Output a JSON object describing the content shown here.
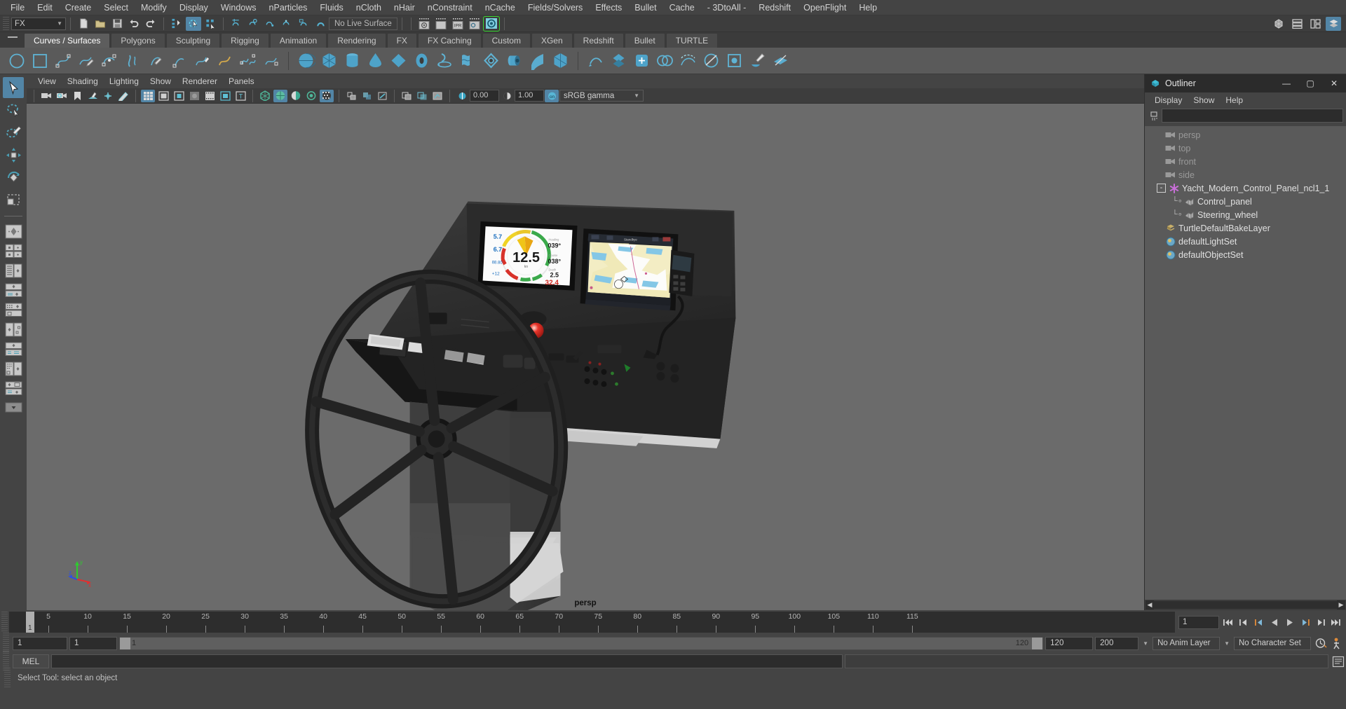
{
  "app": {
    "title": "Autodesk Maya"
  },
  "menubar": {
    "items": [
      "File",
      "Edit",
      "Create",
      "Select",
      "Modify",
      "Display",
      "Windows",
      "nParticles",
      "Fluids",
      "nCloth",
      "nHair",
      "nConstraint",
      "nCache",
      "Fields/Solvers",
      "Effects",
      "Bullet",
      "Cache",
      "- 3DtoAll -",
      "Redshift",
      "OpenFlight",
      "Help"
    ]
  },
  "statusline": {
    "menuset": "FX",
    "live_surface": "No Live Surface",
    "icons": [
      "new-scene-icon",
      "open-scene-icon",
      "save-scene-icon",
      "undo-icon",
      "redo-icon",
      "select-by-hierarchy-icon",
      "select-by-object-icon",
      "select-by-component-icon",
      "snap-to-grid-icon",
      "snap-to-curve-icon",
      "snap-to-point-icon",
      "snap-to-projected-center-icon",
      "snap-to-view-plane-icon",
      "magnet-icon",
      "render-current-frame-icon",
      "render-sequence-icon",
      "ipr-render-icon",
      "render-settings-icon",
      "hypershade-icon"
    ],
    "right_icons": [
      "show-hide-modeling-toolkit-icon",
      "show-hide-attribute-editor-icon",
      "show-hide-tool-settings-icon",
      "show-hide-channel-box-icon"
    ]
  },
  "shelf": {
    "tabs": [
      "Curves / Surfaces",
      "Polygons",
      "Sculpting",
      "Rigging",
      "Animation",
      "Rendering",
      "FX",
      "FX Caching",
      "Custom",
      "XGen",
      "Redshift",
      "Bullet",
      "TURTLE"
    ],
    "active_tab": "Curves / Surfaces",
    "icons": [
      "nurbs-circle-icon",
      "nurbs-square-icon",
      "cv-curve-tool-icon",
      "ep-curve-tool-icon",
      "bezier-curve-tool-icon",
      "pencil-curve-tool-icon",
      "three-point-arc-icon",
      "two-point-arc-icon",
      "add-points-tool-icon",
      "attach-curves-icon",
      "detach-curves-icon",
      "insert-knot-icon",
      "offset-curve-icon",
      "poly-sphere-icon",
      "poly-cube-icon",
      "poly-cylinder-icon",
      "poly-cone-icon",
      "poly-plane-icon",
      "poly-torus-icon",
      "revolve-icon",
      "loft-icon",
      "planar-icon",
      "extrude-icon",
      "birail-icon",
      "boundary-icon",
      "square-surface-icon",
      "bevel-icon",
      "bevel-plus-icon",
      "intersect-surfaces-icon",
      "project-curve-icon",
      "trim-tool-icon",
      "untrim-surfaces-icon",
      "sculpt-geometry-tool-icon",
      "surface-editing-icon"
    ]
  },
  "toolbox": {
    "items": [
      "select-tool",
      "lasso-select-tool",
      "paint-select-tool",
      "move-tool",
      "rotate-tool",
      "scale-tool",
      "last-tool-used",
      "layout-single-pane",
      "layout-two-pane-side",
      "layout-two-pane-stacked",
      "layout-three-pane",
      "layout-four-pane",
      "layout-persp-outliner",
      "layout-hypershade",
      "layout-persp-graph",
      "layout-outliner-persp",
      "layout-more"
    ],
    "active": "select-tool"
  },
  "viewport": {
    "menus": [
      "View",
      "Shading",
      "Lighting",
      "Show",
      "Renderer",
      "Panels"
    ],
    "camera_label": "persp",
    "exposure": "0.00",
    "gamma": "1.00",
    "color_space": "sRGB gamma",
    "toolbar_icons": [
      "select-camera-icon",
      "camera-attributes-icon",
      "bookmark-icon",
      "image-plane-icon",
      "two-d-pan-zoom-icon",
      "grease-pencil-icon",
      "grid-icon",
      "film-gate-icon",
      "resolution-gate-icon",
      "gate-mask-icon",
      "film-origin-icon",
      "safe-action-icon",
      "safe-title-icon",
      "wireframe-icon",
      "smooth-shade-all-icon",
      "shaded-with-wireframe-icon",
      "use-all-lights-icon",
      "shadows-icon",
      "screen-space-ao-icon",
      "motion-blur-icon",
      "multisample-aa-icon",
      "depth-of-field-icon",
      "isolate-select-icon",
      "xray-icon",
      "xray-joints-icon",
      "xray-active-components-icon",
      "exposure-icon",
      "gamma-icon",
      "color-management-icon"
    ],
    "axis_labels": [
      "x",
      "y",
      "z"
    ]
  },
  "outliner": {
    "title": "Outliner",
    "window_buttons": [
      "minimize",
      "maximize",
      "close"
    ],
    "menus": [
      "Display",
      "Show",
      "Help"
    ],
    "search_placeholder": "",
    "search_value": "",
    "tree": [
      {
        "label": "persp",
        "icon": "camera-icon",
        "indent": 2,
        "dim": true,
        "expander": ""
      },
      {
        "label": "top",
        "icon": "camera-icon",
        "indent": 2,
        "dim": true,
        "expander": ""
      },
      {
        "label": "front",
        "icon": "camera-icon",
        "indent": 2,
        "dim": true,
        "expander": ""
      },
      {
        "label": "side",
        "icon": "camera-icon",
        "indent": 2,
        "dim": true,
        "expander": ""
      },
      {
        "label": "Yacht_Modern_Control_Panel_ncl1_1",
        "icon": "transform-icon",
        "indent": 1,
        "dim": false,
        "expander": "-"
      },
      {
        "label": "Control_panel",
        "icon": "mesh-icon",
        "indent": 3,
        "dim": false,
        "expander": ""
      },
      {
        "label": "Steering_wheel",
        "icon": "mesh-icon",
        "indent": 3,
        "dim": false,
        "expander": ""
      },
      {
        "label": "TurtleDefaultBakeLayer",
        "icon": "bakelayer-icon",
        "indent": 2,
        "dim": false,
        "expander": ""
      },
      {
        "label": "defaultLightSet",
        "icon": "set-icon",
        "indent": 2,
        "dim": false,
        "expander": ""
      },
      {
        "label": "defaultObjectSet",
        "icon": "set-icon",
        "indent": 2,
        "dim": false,
        "expander": ""
      }
    ]
  },
  "timeline": {
    "ticks": [
      5,
      10,
      15,
      20,
      25,
      30,
      35,
      40,
      45,
      50,
      55,
      60,
      65,
      70,
      75,
      80,
      85,
      90,
      95,
      100,
      105,
      110,
      115
    ],
    "current_frame": "1",
    "playhead_label": "1",
    "playback_buttons": [
      "go-to-start",
      "step-back-frame",
      "step-back-key",
      "play-backwards",
      "play-forwards",
      "step-forward-key",
      "step-forward-frame",
      "go-to-end"
    ]
  },
  "rangeslider": {
    "start_field": "1",
    "range_start_field": "1",
    "slider_label": "1",
    "slider_end_label": "120",
    "range_end_field": "120",
    "end_field": "200",
    "anim_layer": "No Anim Layer",
    "character_set": "No Character Set",
    "right_icons": [
      "animation-preferences-icon",
      "animation-toggle-icon"
    ]
  },
  "commandline": {
    "language": "MEL",
    "input_value": "",
    "output_value": "",
    "script-editor-icon": "script-editor-icon"
  },
  "helpline": {
    "text": "Select Tool: select an object"
  },
  "scene": {
    "description": "3D render of a modern yacht control panel with steering wheel",
    "instrument_display": {
      "speed": "12.5",
      "speed_unit": "kn",
      "heading": "039°",
      "course": "038°",
      "depth": "2.5",
      "temperature": "32.4",
      "left_values": [
        "5.7",
        "6.7",
        "88.80",
        "+12"
      ]
    },
    "chartplotter": {
      "title": "Standbye"
    }
  },
  "colors": {
    "accent": "#5285a6",
    "shelf_bg": "#5a5a5a",
    "panel_bg": "#444444",
    "viewport_bg": "#6b6b6b",
    "dark_field": "#2c2c2c",
    "highlight_green": "#39d832",
    "playhead_orange": "#d4762a"
  }
}
